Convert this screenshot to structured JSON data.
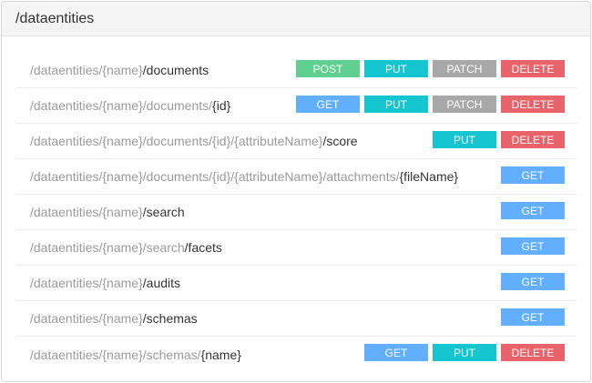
{
  "header": {
    "title": "/dataentities"
  },
  "colors": {
    "GET": "#61affe",
    "PUT": "#15c5cf",
    "POST": "#5fd08f",
    "PATCH": "#a8a8a8",
    "DELETE": "#e8646a"
  },
  "endpoints": [
    {
      "segments": [
        {
          "t": "/dataentities/{name}",
          "hl": false
        },
        {
          "t": "/documents",
          "hl": true
        }
      ],
      "methods": [
        "POST",
        "PUT",
        "PATCH",
        "DELETE"
      ]
    },
    {
      "segments": [
        {
          "t": "/dataentities/{name}/documents/",
          "hl": false
        },
        {
          "t": "{id}",
          "hl": true
        }
      ],
      "methods": [
        "GET",
        "PUT",
        "PATCH",
        "DELETE"
      ]
    },
    {
      "segments": [
        {
          "t": "/dataentities/{name}/documents/{id}/{attributeName}",
          "hl": false
        },
        {
          "t": "/score",
          "hl": true
        }
      ],
      "methods": [
        "PUT",
        "DELETE"
      ]
    },
    {
      "segments": [
        {
          "t": "/dataentities/{name}/documents/{id}/{attributeName}/attachments/",
          "hl": false
        },
        {
          "t": "{fileName}",
          "hl": true
        }
      ],
      "methods": [
        "GET"
      ]
    },
    {
      "segments": [
        {
          "t": "/dataentities/{name}",
          "hl": false
        },
        {
          "t": "/search",
          "hl": true
        }
      ],
      "methods": [
        "GET"
      ]
    },
    {
      "segments": [
        {
          "t": "/dataentities/{name}/search",
          "hl": false
        },
        {
          "t": "/facets",
          "hl": true
        }
      ],
      "methods": [
        "GET"
      ]
    },
    {
      "segments": [
        {
          "t": "/dataentities/{name}",
          "hl": false
        },
        {
          "t": "/audits",
          "hl": true
        }
      ],
      "methods": [
        "GET"
      ]
    },
    {
      "segments": [
        {
          "t": "/dataentities/{name}",
          "hl": false
        },
        {
          "t": "/schemas",
          "hl": true
        }
      ],
      "methods": [
        "GET"
      ]
    },
    {
      "segments": [
        {
          "t": "/dataentities/{name}/schemas/",
          "hl": false
        },
        {
          "t": "{name}",
          "hl": true
        }
      ],
      "methods": [
        "GET",
        "PUT",
        "DELETE"
      ]
    }
  ]
}
